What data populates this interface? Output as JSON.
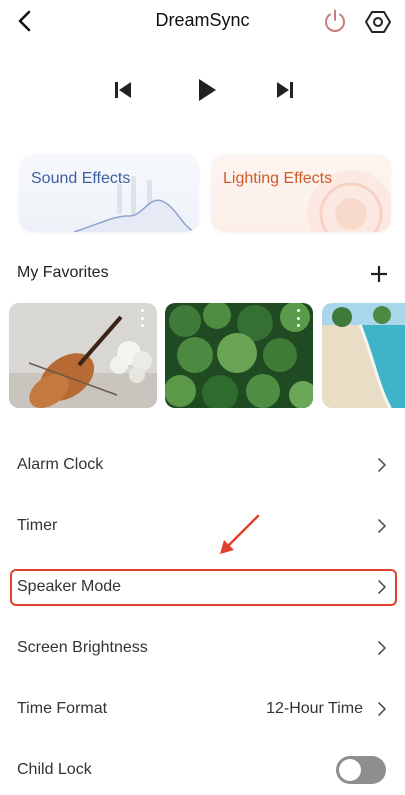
{
  "header": {
    "title": "DreamSync",
    "back_icon": "back-arrow-icon",
    "power_icon": "power-icon",
    "settings_icon": "hex-gear-icon",
    "power_color": "#c97d7d"
  },
  "player": {
    "prev_icon": "skip-previous-icon",
    "play_icon": "play-icon",
    "next_icon": "skip-next-icon"
  },
  "effects": {
    "sound_label": "Sound Effects",
    "lighting_label": "Lighting Effects",
    "sound_color": "#3c5fa0",
    "lighting_color": "#d05a2a"
  },
  "favorites": {
    "title": "My Favorites",
    "add_icon": "plus-icon",
    "items": [
      {
        "name": "violin-thumbnail",
        "more_icon": "more-vertical-icon"
      },
      {
        "name": "forest-thumbnail",
        "more_icon": "more-vertical-icon"
      },
      {
        "name": "beach-thumbnail"
      }
    ]
  },
  "settings": {
    "items": [
      {
        "label": "Alarm Clock",
        "icon": "chevron-right-icon"
      },
      {
        "label": "Timer",
        "icon": "chevron-right-icon"
      },
      {
        "label": "Speaker Mode",
        "icon": "chevron-right-icon",
        "highlighted": true
      },
      {
        "label": "Screen Brightness",
        "icon": "chevron-right-icon"
      },
      {
        "label": "Time Format",
        "value": "12-Hour Time",
        "icon": "chevron-right-icon"
      },
      {
        "label": "Child Lock",
        "toggle": false
      }
    ]
  },
  "annotation": {
    "arrow_color": "#e0422e"
  }
}
